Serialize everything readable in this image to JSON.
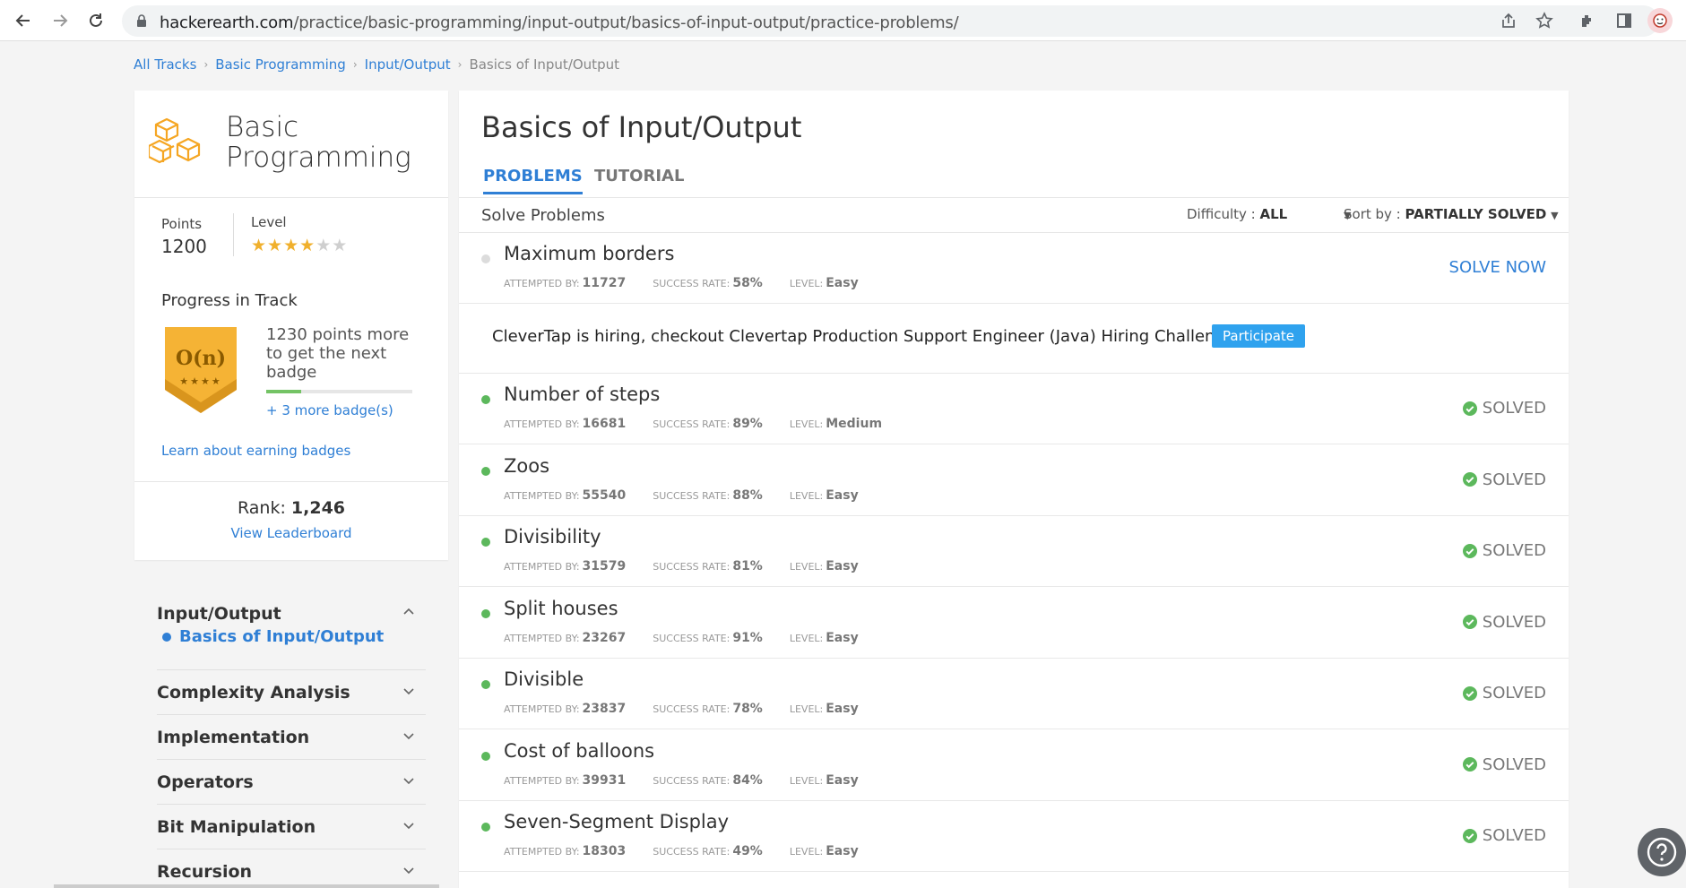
{
  "browser": {
    "url_host": "hackerearth.com",
    "url_path": "/practice/basic-programming/input-output/basics-of-input-output/practice-problems/"
  },
  "breadcrumb": [
    "All Tracks",
    "Basic Programming",
    "Input/Output",
    "Basics of Input/Output"
  ],
  "track": {
    "title_line1": "Basic",
    "title_line2": "Programming",
    "points_label": "Points",
    "points_value": "1200",
    "level_label": "Level",
    "level_stars": 4,
    "level_stars_total": 6,
    "progress_title": "Progress in Track",
    "badge_label": "O(n)",
    "badge_stars": "★★★★",
    "badge_text": "1230 points more to get the next badge",
    "progress_fraction": 0.24,
    "more_badges": "+ 3 more badge(s)",
    "learn_link": "Learn about earning badges",
    "rank_label": "Rank:",
    "rank_value": "1,246",
    "leaderboard_link": "View Leaderboard"
  },
  "side_nav": {
    "sections": [
      {
        "label": "Input/Output",
        "expanded": true,
        "sub": "Basics of Input/Output"
      },
      {
        "label": "Complexity Analysis"
      },
      {
        "label": "Implementation"
      },
      {
        "label": "Operators"
      },
      {
        "label": "Bit Manipulation"
      },
      {
        "label": "Recursion"
      }
    ]
  },
  "main": {
    "title": "Basics of Input/Output",
    "tab_problems": "PROBLEMS",
    "tab_tutorial": "TUTORIAL",
    "solve_label": "Solve Problems",
    "difficulty_label": "Difficulty :",
    "difficulty_value": "ALL",
    "sort_label": "Sort by :",
    "sort_value": "PARTIALLY SOLVED",
    "meta_attempted": "ATTEMPTED BY:",
    "meta_success": "SUCCESS RATE:",
    "meta_level": "LEVEL:",
    "promo_text": "CleverTap is hiring, checkout Clevertap Production Support Engineer (Java) Hiring Challenge",
    "promo_button": "Participate",
    "solve_now": "SOLVE NOW",
    "solved_label": "SOLVED",
    "problems": [
      {
        "name": "Maximum borders",
        "attempted": "11727",
        "success": "58%",
        "level": "Easy",
        "solved": false
      },
      {
        "name": "Number of steps",
        "attempted": "16681",
        "success": "89%",
        "level": "Medium",
        "solved": true
      },
      {
        "name": "Zoos",
        "attempted": "55540",
        "success": "88%",
        "level": "Easy",
        "solved": true
      },
      {
        "name": "Divisibility",
        "attempted": "31579",
        "success": "81%",
        "level": "Easy",
        "solved": true
      },
      {
        "name": "Split houses",
        "attempted": "23267",
        "success": "91%",
        "level": "Easy",
        "solved": true
      },
      {
        "name": "Divisible",
        "attempted": "23837",
        "success": "78%",
        "level": "Easy",
        "solved": true
      },
      {
        "name": "Cost of balloons",
        "attempted": "39931",
        "success": "84%",
        "level": "Easy",
        "solved": true
      },
      {
        "name": "Seven-Segment Display",
        "attempted": "18303",
        "success": "49%",
        "level": "Easy",
        "solved": true
      }
    ]
  },
  "colors": {
    "accent": "#2f7fd5",
    "solved": "#5cb85c",
    "badge": "#f5b335"
  }
}
